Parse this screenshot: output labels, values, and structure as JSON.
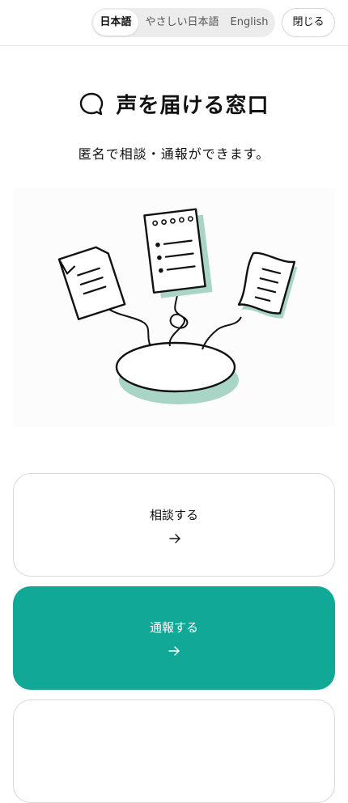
{
  "header": {
    "languages": [
      {
        "label": "日本語",
        "active": true
      },
      {
        "label": "やさしい日本語",
        "active": false
      },
      {
        "label": "English",
        "active": false
      }
    ],
    "close_label": "閉じる"
  },
  "main": {
    "title": "声を届ける窓口",
    "title_icon": "speech-bubble-icon",
    "subtitle": "匿名で相談・通報ができます。"
  },
  "actions": [
    {
      "label": "相談する",
      "icon": "arrow-right-icon",
      "style": "outline"
    },
    {
      "label": "通報する",
      "icon": "arrow-right-icon",
      "style": "filled"
    }
  ],
  "colors": {
    "accent": "#12a897",
    "accent_light": "#a9d5c6",
    "border": "#d9d9d9",
    "lang_bg": "#ececec",
    "text": "#111111"
  }
}
